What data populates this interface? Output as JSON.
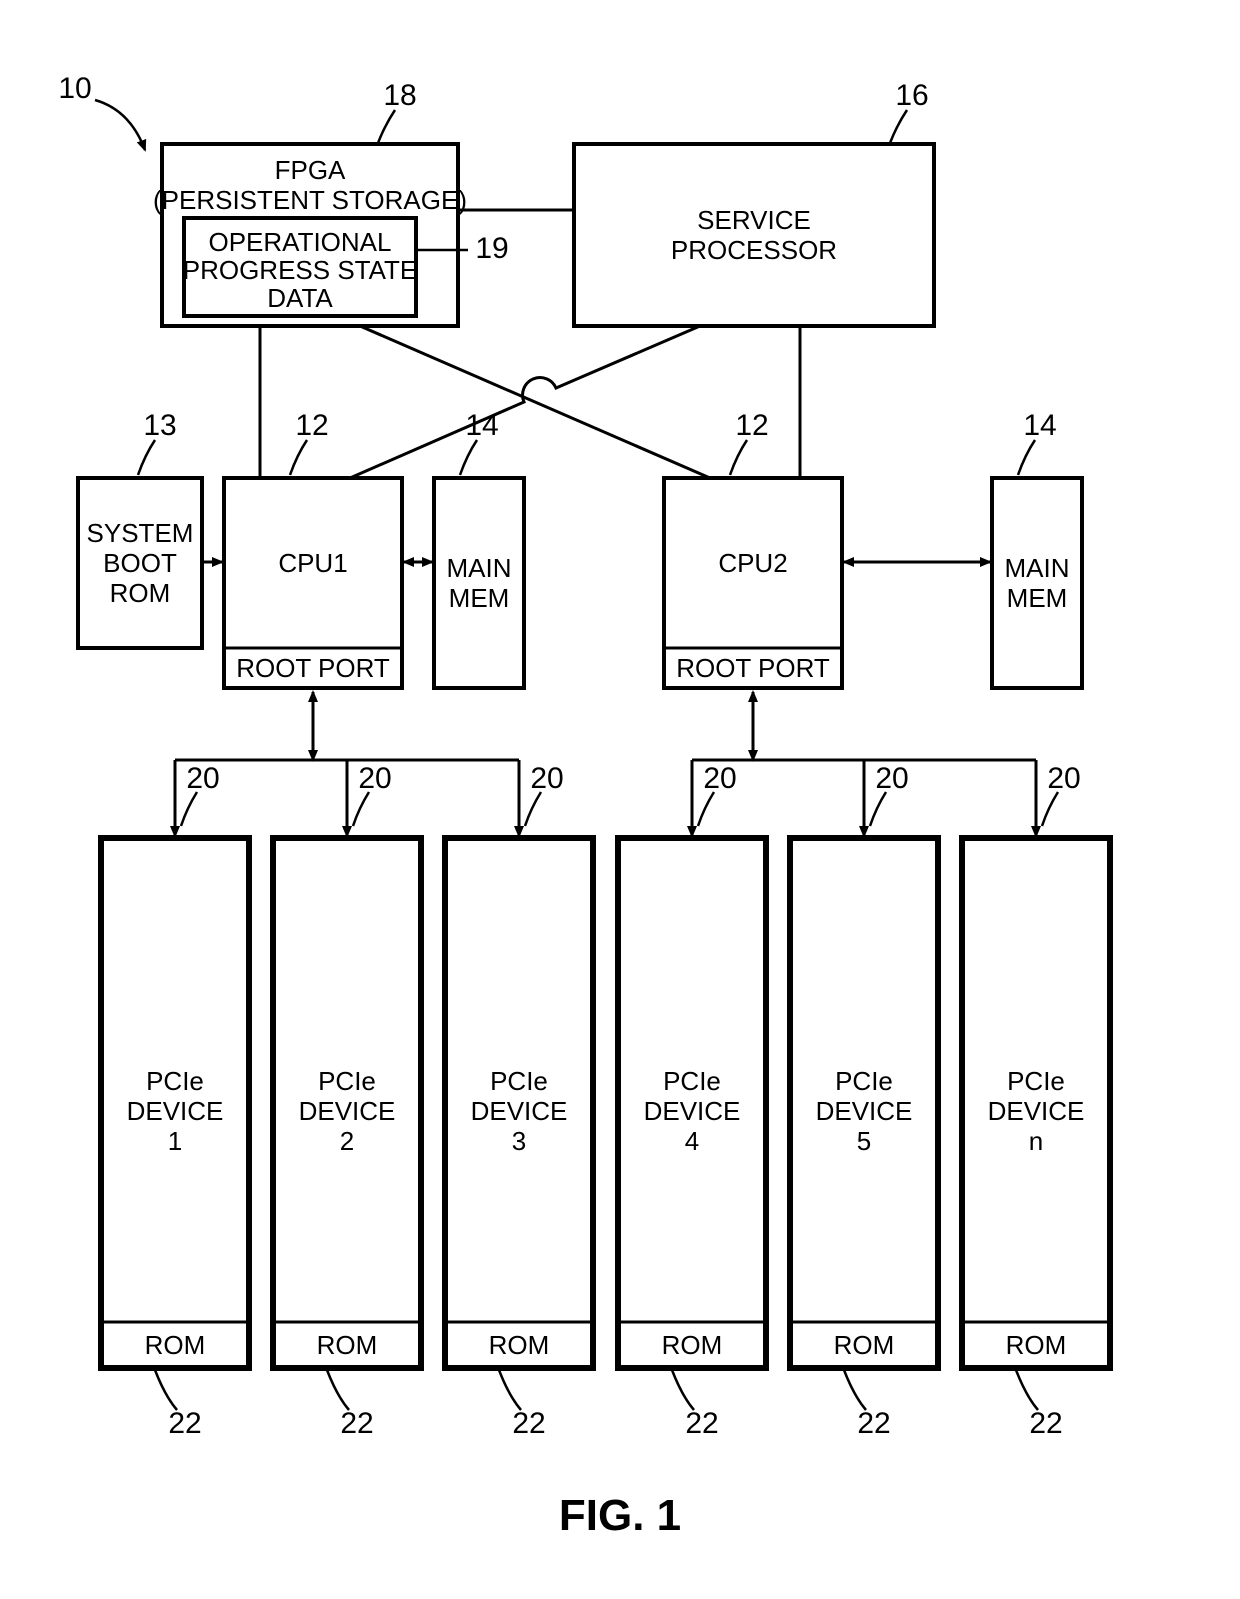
{
  "figure_label": "FIG. 1",
  "refs": {
    "system": "10",
    "boot_rom": "13",
    "fpga": "18",
    "opsd": "19",
    "svc_proc": "16",
    "cpu": "12",
    "mem": "14",
    "pcie": "20",
    "rom": "22"
  },
  "blocks": {
    "fpga_line1": "FPGA",
    "fpga_line2": "(PERSISTENT STORAGE)",
    "opsd_line1": "OPERATIONAL",
    "opsd_line2": "PROGRESS STATE",
    "opsd_line3": "DATA",
    "svc_line1": "SERVICE",
    "svc_line2": "PROCESSOR",
    "boot_line1": "SYSTEM",
    "boot_line2": "BOOT",
    "boot_line3": "ROM",
    "cpu1": "CPU1",
    "cpu2": "CPU2",
    "root_port": "ROOT PORT",
    "mem_line1": "MAIN",
    "mem_line2": "MEM",
    "pcie_line1": "PCIe",
    "pcie_line2": "DEVICE",
    "rom": "ROM"
  },
  "pcie_ids": [
    "1",
    "2",
    "3",
    "4",
    "5",
    "n"
  ]
}
